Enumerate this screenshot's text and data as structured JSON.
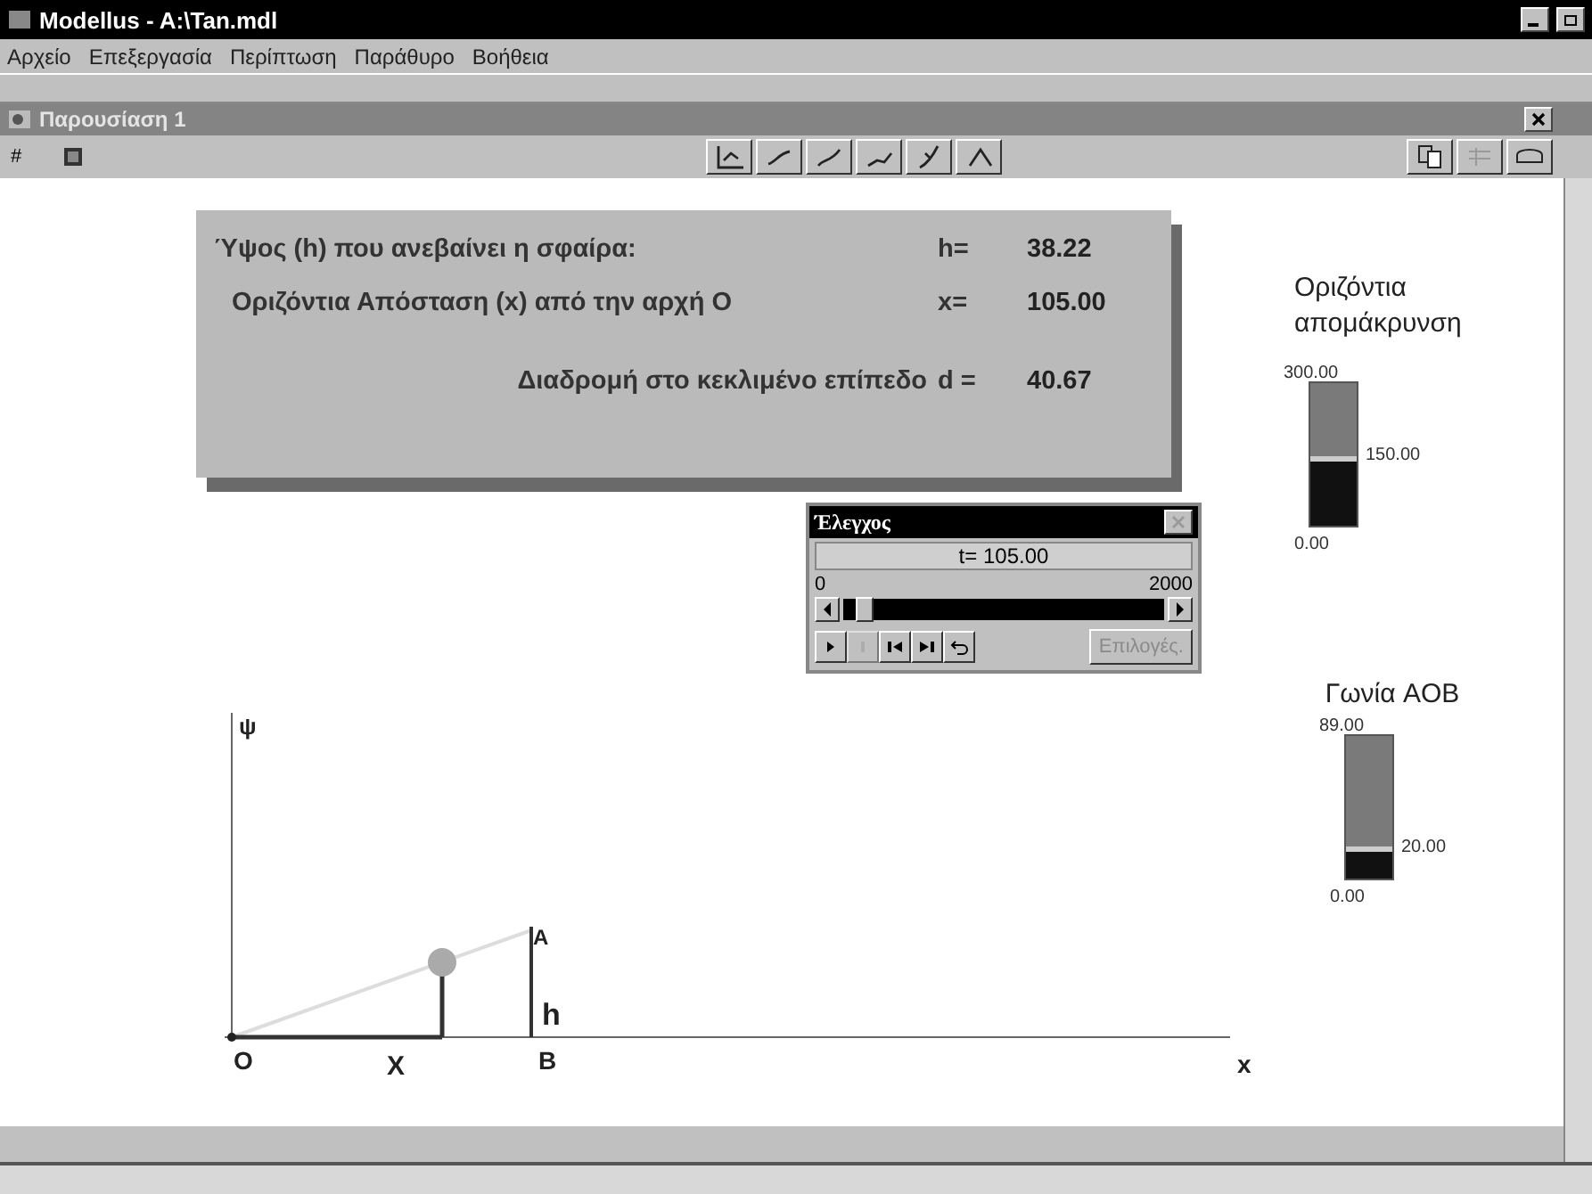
{
  "window": {
    "title": "Modellus - A:\\Tan.mdl"
  },
  "menu": [
    "Αρχείο",
    "Επεξεργασία",
    "Περίπτωση",
    "Παράθυρο",
    "Βοήθεια"
  ],
  "document": {
    "title": "Παρουσίαση 1",
    "toolbar_mark": "#"
  },
  "readout_panel": {
    "rows": [
      {
        "label": "Ύψος (h) που ανεβαίνει  η σφαίρα:",
        "symbol": "h=",
        "value": "38.22"
      },
      {
        "label": "Οριζόντια Απόσταση (x) από την αρχή O",
        "symbol": "x=",
        "value": "105.00"
      },
      {
        "label": "Διαδρομή στο κεκλιμένο επίπεδο",
        "symbol": "d =",
        "value": "40.67"
      }
    ]
  },
  "control": {
    "title": "Έλεγχος",
    "time": "t=  105.00",
    "min": "0",
    "max": "2000",
    "level": 0.05,
    "buttons": [
      {
        "kind": "play",
        "disabled": false
      },
      {
        "kind": "pause",
        "disabled": true
      },
      {
        "kind": "step_back",
        "disabled": false
      },
      {
        "kind": "step_forward",
        "disabled": false
      },
      {
        "kind": "replay",
        "disabled": false
      }
    ],
    "options": {
      "label": "Επιλογές.",
      "disabled": true
    }
  },
  "meters": [
    {
      "title": "Οριζόντια απομάκρυνση",
      "max": "300.00",
      "mid": "150.00",
      "min": "0.00",
      "level": 0.49
    },
    {
      "title": "Γωνία AOB",
      "max": "89.00",
      "mid": "20.00",
      "min": "0.00",
      "level": 0.22
    }
  ],
  "graph": {
    "labels": [
      {
        "kind": "y_axis",
        "text": "ψ"
      },
      {
        "kind": "top",
        "text": "A"
      },
      {
        "kind": "height",
        "text": "h"
      },
      {
        "kind": "origin",
        "text": "O"
      },
      {
        "kind": "position",
        "text": "X"
      },
      {
        "kind": "foot",
        "text": "B"
      },
      {
        "kind": "x_axis",
        "text": "x"
      }
    ]
  }
}
